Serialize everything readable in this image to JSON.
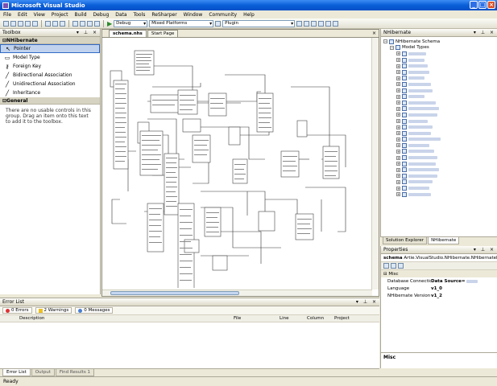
{
  "window": {
    "title": "Microsoft Visual Studio"
  },
  "menu": [
    "File",
    "Edit",
    "View",
    "Project",
    "Build",
    "Debug",
    "Data",
    "Tools",
    "ReSharper",
    "Window",
    "Community",
    "Help"
  ],
  "toolbar": {
    "config": "Debug",
    "platform": "Mixed Platforms",
    "startup": "Plugin"
  },
  "toolbox": {
    "title": "Toolbox",
    "group": "NHibernate",
    "items": [
      {
        "label": "Pointer",
        "icon": "pointer-icon",
        "glyph": "↖"
      },
      {
        "label": "Model Type",
        "icon": "class-icon",
        "glyph": "▭"
      },
      {
        "label": "Foreign Key",
        "icon": "key-icon",
        "glyph": "⚷"
      },
      {
        "label": "Bidirectional Association",
        "icon": "line-icon",
        "glyph": "╱"
      },
      {
        "label": "Unidirectional Association",
        "icon": "line-icon",
        "glyph": "╱"
      },
      {
        "label": "Inheritance",
        "icon": "line-icon",
        "glyph": "╱"
      }
    ],
    "general_group": "General",
    "empty_text": "There are no usable controls in this group. Drag an item onto this text to add it to the toolbox."
  },
  "document": {
    "tabs": [
      "schema.nhs",
      "Start Page"
    ],
    "active_tab": 0
  },
  "error_list": {
    "title": "Error List",
    "filters": [
      "0 Errors",
      "2 Warnings",
      "0 Messages"
    ],
    "columns": [
      "Description",
      "File",
      "Line",
      "Column",
      "Project"
    ]
  },
  "bottom_tabs": [
    "Error List",
    "Output",
    "Find Results 1"
  ],
  "nhibernate_panel": {
    "title": "NHibernate",
    "root": "NHibernate Schema",
    "model_types": "Model Types"
  },
  "right_tabs": [
    "Solution Explorer",
    "NHibernate"
  ],
  "properties": {
    "title": "Properties",
    "object_name": "schema",
    "object_type": "Artie.VisualStudio.NHibernate.NHibernateDiagram",
    "category": "Misc",
    "rows": [
      {
        "name": "Database Connection String",
        "value": "Data Source="
      },
      {
        "name": "Language",
        "value": "v1_0"
      },
      {
        "name": "NHibernate Version",
        "value": "v1_2"
      }
    ],
    "description": "Misc"
  },
  "status": "Ready"
}
